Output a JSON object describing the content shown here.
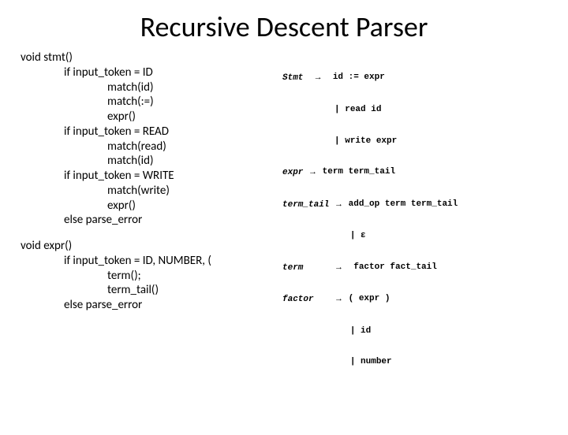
{
  "title": "Recursive Descent Parser",
  "pseudocode": {
    "stmt": {
      "sig": "void stmt()",
      "l1": "if input_token = ID",
      "l1a": "match(id)",
      "l1b": "match(:=)",
      "l1c": "expr()",
      "l2": "if input_token = READ",
      "l2a": "match(read)",
      "l2b": "match(id)",
      "l3": "if input_token = WRITE",
      "l3a": "match(write)",
      "l3b": "expr()",
      "l4": "else parse_error"
    },
    "expr": {
      "sig": "void expr()",
      "l1": "if input_token = ID, NUMBER, (",
      "l1a": "term();",
      "l1b": "term_tail()",
      "l2": "else parse_error"
    }
  },
  "grammar": {
    "arrow": "→",
    "r1_lhs": "Stmt",
    "r1_rhs": "id := expr",
    "r1_alt1": "| read id",
    "r1_alt2": "| write expr",
    "r2_lhs": "expr",
    "r2_rhs": "term term_tail",
    "r3_lhs": "term_tail",
    "r3_rhs": "add_op term term_tail",
    "r3_alt1": "| ε",
    "r4_lhs": "term",
    "r4_rhs": " factor fact_tail",
    "r5_lhs": "factor",
    "r5_rhs": "( expr )",
    "r5_alt1": "| id",
    "r5_alt2": "| number"
  }
}
